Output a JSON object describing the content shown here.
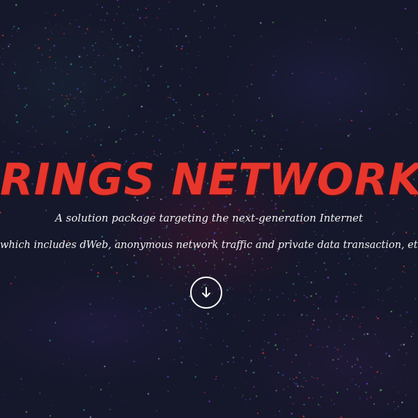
{
  "hero": {
    "title": "RINGS NETWORK",
    "subtitle_line1": "A solution package targeting the next-generation Internet",
    "subtitle_line2": "which includes dWeb, anonymous network traffic and private data transaction, etc.",
    "scroll_icon": "arrow-down-icon"
  },
  "colors": {
    "background": "#15172a",
    "title": "#e8362c",
    "text": "#f2f2f2",
    "particle_red": "#e8362c",
    "particle_purple": "#8a3bd6",
    "particle_blue": "#3a5bd0",
    "particle_teal": "#2fa7a0",
    "particle_green": "#4caf50"
  }
}
